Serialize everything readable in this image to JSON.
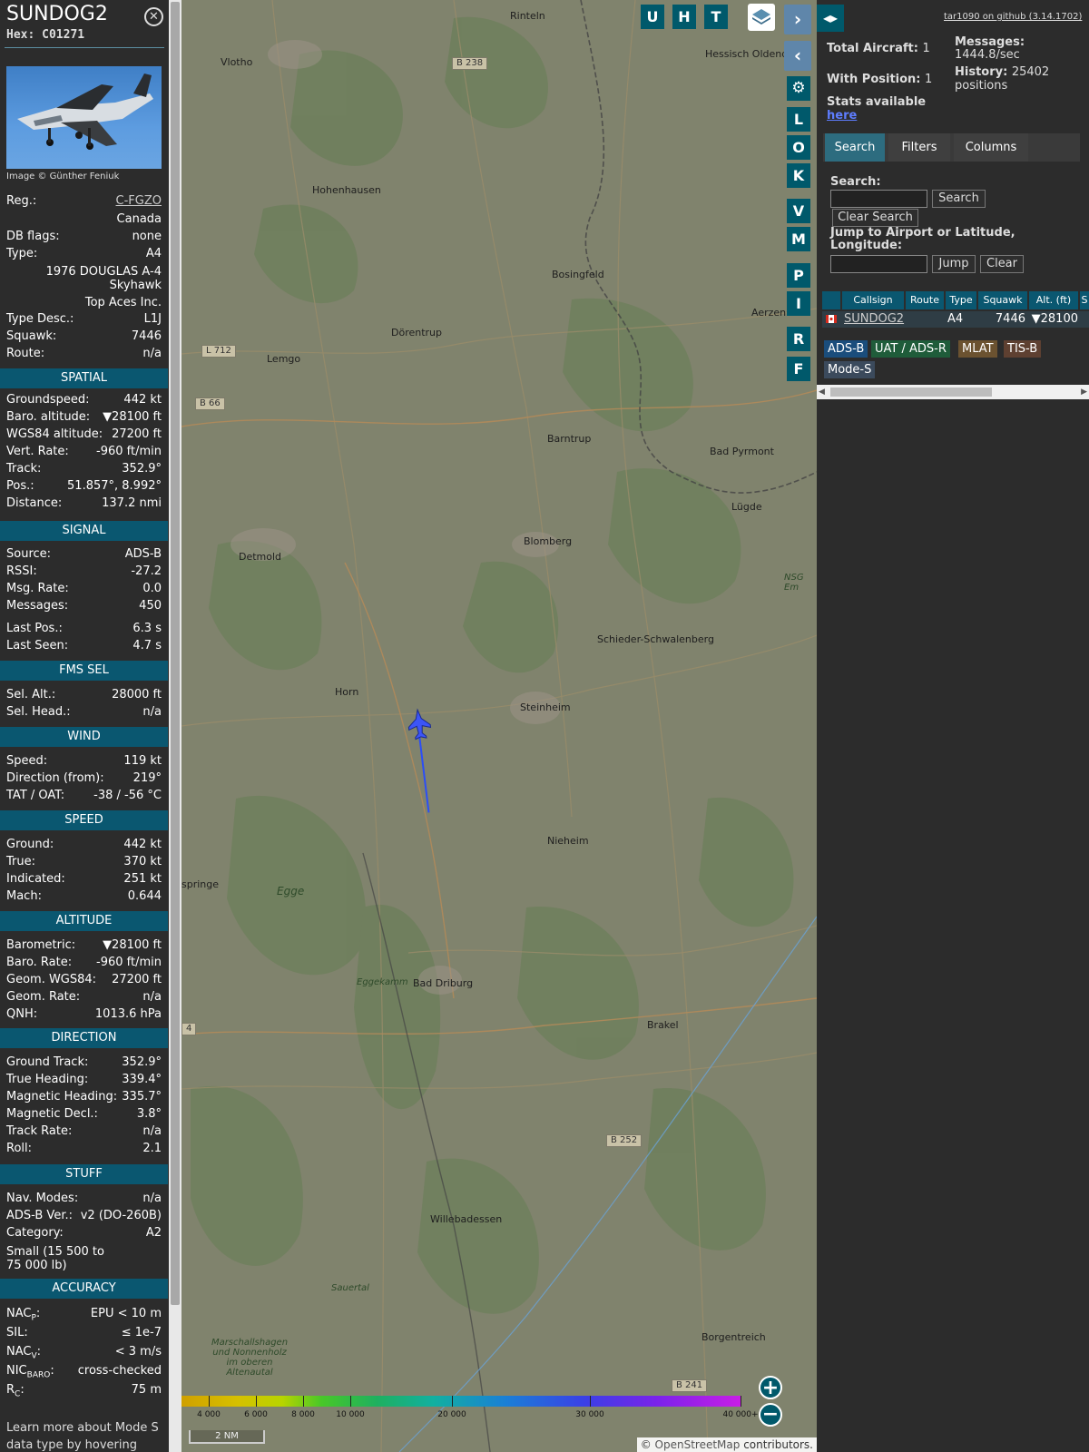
{
  "sidebar": {
    "callsign": "SUNDOG2",
    "hex_label": "Hex:",
    "hex": "C01271",
    "close": "✕",
    "photo_credit": "Image © Günther Feniuk",
    "reg_label": "Reg.:",
    "reg": "C-FGZO",
    "country": "Canada",
    "dbflags_label": "DB flags:",
    "dbflags": "none",
    "type_label": "Type:",
    "type": "A4",
    "model_line1": "1976 DOUGLAS A-4",
    "model_line2": "Skyhawk",
    "operator": "Top Aces Inc.",
    "typedesc_label": "Type Desc.:",
    "typedesc": "L1J",
    "squawk_label": "Squawk:",
    "squawk": "7446",
    "route_label": "Route:",
    "route": "n/a",
    "sections": {
      "spatial": "SPATIAL",
      "signal": "SIGNAL",
      "fms": "FMS SEL",
      "wind": "WIND",
      "speed": "SPEED",
      "altitude": "ALTITUDE",
      "direction": "DIRECTION",
      "stuff": "STUFF",
      "accuracy": "ACCURACY"
    },
    "spatial": [
      {
        "k": "Groundspeed:",
        "v": "442 kt"
      },
      {
        "k": "Baro. altitude:",
        "v": "▼28100 ft"
      },
      {
        "k": "WGS84 altitude:",
        "v": "27200 ft"
      },
      {
        "k": "Vert. Rate:",
        "v": "-960 ft/min"
      },
      {
        "k": "Track:",
        "v": "352.9°"
      },
      {
        "k": "Pos.:",
        "v": "51.857°, 8.992°"
      },
      {
        "k": "Distance:",
        "v": "137.2 nmi"
      }
    ],
    "signal": [
      {
        "k": "Source:",
        "v": "ADS-B"
      },
      {
        "k": "RSSI:",
        "v": "-27.2"
      },
      {
        "k": "Msg. Rate:",
        "v": "0.0"
      },
      {
        "k": "Messages:",
        "v": "450"
      },
      {
        "k": "Last Pos.:",
        "v": "6.3 s"
      },
      {
        "k": "Last Seen:",
        "v": "4.7 s"
      }
    ],
    "fms": [
      {
        "k": "Sel. Alt.:",
        "v": "28000 ft"
      },
      {
        "k": "Sel. Head.:",
        "v": "n/a"
      }
    ],
    "wind": [
      {
        "k": "Speed:",
        "v": "119 kt"
      },
      {
        "k": "Direction (from):",
        "v": "219°"
      },
      {
        "k": "TAT / OAT:",
        "v": "-38 / -56 °C"
      }
    ],
    "speed": [
      {
        "k": "Ground:",
        "v": "442 kt"
      },
      {
        "k": "True:",
        "v": "370 kt"
      },
      {
        "k": "Indicated:",
        "v": "251 kt"
      },
      {
        "k": "Mach:",
        "v": "0.644"
      }
    ],
    "altitude": [
      {
        "k": "Barometric:",
        "v": "▼28100 ft"
      },
      {
        "k": "Baro. Rate:",
        "v": "-960 ft/min"
      },
      {
        "k": "Geom. WGS84:",
        "v": "27200 ft"
      },
      {
        "k": "Geom. Rate:",
        "v": "n/a"
      },
      {
        "k": "QNH:",
        "v": "1013.6 hPa"
      }
    ],
    "direction": [
      {
        "k": "Ground Track:",
        "v": "352.9°"
      },
      {
        "k": "True Heading:",
        "v": "339.4°"
      },
      {
        "k": "Magnetic Heading:",
        "v": "335.7°"
      },
      {
        "k": "Magnetic Decl.:",
        "v": "3.8°"
      },
      {
        "k": "Track Rate:",
        "v": "n/a"
      },
      {
        "k": "Roll:",
        "v": "2.1"
      }
    ],
    "stuff": [
      {
        "k": "Nav. Modes:",
        "v": "n/a"
      },
      {
        "k": "ADS-B Ver.:",
        "v": "v2 (DO-260B)"
      },
      {
        "k": "Category:",
        "v": "A2"
      }
    ],
    "category_desc_line1": "Small (15 500 to",
    "category_desc_line2": "75 000 lb)",
    "accuracy": [
      {
        "k": "NAC",
        "sub": "P",
        "v": "EPU < 10 m"
      },
      {
        "k": "SIL:",
        "sub": "",
        "v": "≤ 1e-7"
      },
      {
        "k": "NAC",
        "sub": "V",
        "v": "< 3 m/s"
      },
      {
        "k": "NIC",
        "sub": "BARO",
        "v": "cross-checked"
      },
      {
        "k": "R",
        "sub": "C",
        "v": "75 m"
      }
    ],
    "footer_line1": "Learn more about Mode S",
    "footer_line2": "data type by hovering over"
  },
  "map": {
    "top_buttons": [
      "U",
      "H",
      "T"
    ],
    "side_buttons": [
      "L",
      "O",
      "K",
      "V",
      "M",
      "P",
      "I",
      "R",
      "F"
    ],
    "towns": [
      {
        "name": "Rinteln"
      },
      {
        "name": "Vlotho"
      },
      {
        "name": "Hessisch Oldendorf"
      },
      {
        "name": "Hohenhausen"
      },
      {
        "name": "Bosingfeld"
      },
      {
        "name": "Dörentrup"
      },
      {
        "name": "Lemgo"
      },
      {
        "name": "Aerzen"
      },
      {
        "name": "Barntrup"
      },
      {
        "name": "Bad Pyrmont"
      },
      {
        "name": "Lügde"
      },
      {
        "name": "Detmold"
      },
      {
        "name": "Blomberg"
      },
      {
        "name": "Schieder-Schwalenberg"
      },
      {
        "name": "Horn"
      },
      {
        "name": "Steinheim"
      },
      {
        "name": "Nieheim"
      },
      {
        "name": "Egge"
      },
      {
        "name": "Bad Driburg"
      },
      {
        "name": "Eggekamm"
      },
      {
        "name": "Brakel"
      },
      {
        "name": "Willebadessen"
      },
      {
        "name": "Sauertal"
      },
      {
        "name": "Borgentreich"
      },
      {
        "name": "Marschallshagen und Nonnenholz im oberen Altenautal"
      },
      {
        "name": "springe"
      },
      {
        "name": "NSG Em"
      }
    ],
    "roads": [
      "B 238",
      "L 712",
      "B 66",
      "B 252",
      "B 241",
      "4"
    ],
    "altitude_ticks": [
      "4 000",
      "6 000",
      "8 000",
      "10 000",
      "20 000",
      "30 000",
      "40 000+"
    ],
    "scale": "2 NM",
    "attribution_prefix": "© ",
    "attribution_link": "OpenStreetMap",
    "attribution_suffix": " contributors.",
    "zoom_in": "+",
    "zoom_out": "−"
  },
  "panel": {
    "github": "tar1090 on github (3.14.1702)",
    "total_label": "Total Aircraft:",
    "total": "1",
    "messages_label": "Messages:",
    "messages": "1444.8/sec",
    "withpos_label": "With Position:",
    "withpos": "1",
    "history_label": "History:",
    "history_count": "25402",
    "history_unit": "positions",
    "stats_label": "Stats available",
    "stats_link": "here",
    "tabs": [
      "Search",
      "Filters",
      "Columns"
    ],
    "search_label": "Search:",
    "search_btn": "Search",
    "clear_search": "Clear Search",
    "jump_label": "Jump to Airport or Latitude, Longitude:",
    "jump_btn": "Jump",
    "clear_btn": "Clear",
    "columns": [
      "Callsign",
      "Route",
      "Type",
      "Squawk",
      "Alt. (ft)",
      "S"
    ],
    "row": {
      "callsign": "SUNDOG2",
      "type": "A4",
      "squawk": "7446",
      "alt": "▼28100"
    },
    "tags": [
      "ADS-B",
      "UAT / ADS-R",
      "MLAT",
      "TIS-B",
      "Mode-S"
    ],
    "tag_colors": [
      "#1a4d7c",
      "#1f5c3a",
      "#6b5230",
      "#5e4031",
      "#3b4a5c"
    ]
  }
}
